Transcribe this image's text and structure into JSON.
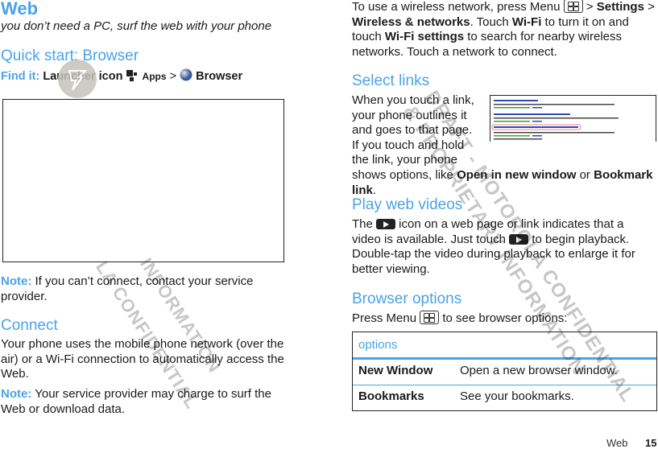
{
  "left": {
    "title": "Web",
    "subtitle": "you don’t need a PC, surf the web with your phone",
    "quick_start": {
      "heading": "Quick start: Browser",
      "find_it_label": "Find it:",
      "launcher": "Launcher icon",
      "apps": "Apps",
      "sep": ">",
      "browser": "Browser"
    },
    "note1_label": "Note:",
    "note1_text": " If you can’t connect, contact your service provider.",
    "connect": {
      "heading": "Connect",
      "text": "Your phone uses the mobile phone network (over the air) or a Wi-Fi connection to automatically access the Web.",
      "note_label": "Note:",
      "note_text": " Your service provider may charge to surf the Web or download data."
    }
  },
  "right": {
    "wireless": {
      "t1": "To use a wireless network, press Menu ",
      "t2": " > ",
      "settings": "Settings",
      "t3": " > ",
      "wn": "Wireless & networks",
      "t4": ". Touch ",
      "wifi": "Wi-Fi",
      "t5": " to turn it on and touch ",
      "wifi_settings": "Wi-Fi settings",
      "t6": " to search for nearby wireless networks. Touch a network to connect."
    },
    "select_links": {
      "heading": "Select links",
      "t1": "When you touch a link, your phone outlines it and goes to that page. If you touch and hold the link, your phone shows options, like ",
      "open": "Open in new window",
      "or": " or ",
      "bookmark": "Bookmark link",
      "end": "."
    },
    "play_videos": {
      "heading": "Play web videos",
      "t1": "The ",
      "t2": " icon on a web page or link indicates that a video is available. Just touch ",
      "t3": " to begin playback. Double-tap the video during playback to enlarge it for better viewing."
    },
    "browser_options": {
      "heading": "Browser options",
      "t1": "Press Menu ",
      "t2": " to see browser options:"
    },
    "table": {
      "header": "options",
      "rows": [
        {
          "name": "New Window",
          "desc": "Open a new browser window."
        },
        {
          "name": "Bookmarks",
          "desc": "See your bookmarks."
        }
      ]
    }
  },
  "footer": {
    "section": "Web",
    "page": "15"
  },
  "watermark": [
    "DRAFT - MOTOROLA CONFIDENTIAL",
    "& PROPRIETARY INFORMATION"
  ],
  "colors": {
    "accent": "#4aa3e8",
    "text": "#1a1a1a"
  },
  "icons": [
    "launcher-icon",
    "browser-globe-icon",
    "menu-key-icon",
    "play-icon",
    "motorola-logo-watermark"
  ]
}
